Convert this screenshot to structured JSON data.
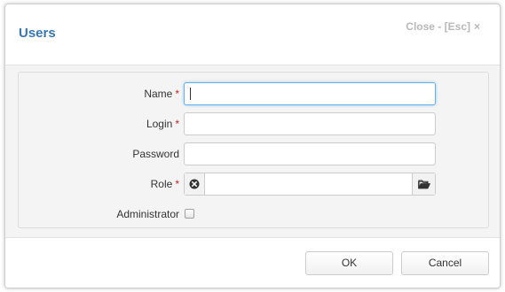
{
  "dialog": {
    "title": "Users",
    "close_label": "Close - [Esc]",
    "close_glyph": "×"
  },
  "form": {
    "name_label": "Name",
    "login_label": "Login",
    "password_label": "Password",
    "role_label": "Role",
    "administrator_label": "Administrator",
    "required_marker": "*",
    "name_value": "",
    "login_value": "",
    "password_value": "",
    "role_value": "",
    "administrator_checked": false
  },
  "footer": {
    "ok_label": "OK",
    "cancel_label": "Cancel"
  },
  "icons": {
    "role_clear": "clear-circle-icon",
    "role_browse": "folder-open-icon"
  },
  "colors": {
    "title": "#3a76b0",
    "required": "#cc2222",
    "focus": "#66afe9"
  }
}
